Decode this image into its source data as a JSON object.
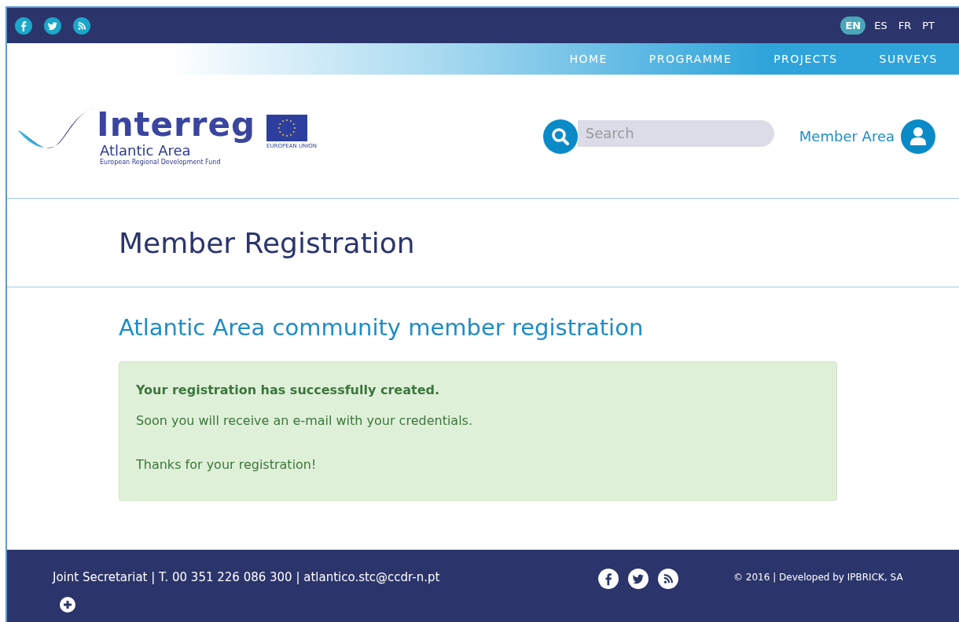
{
  "top_bar": {
    "social": [
      {
        "kind": "facebook"
      },
      {
        "kind": "twitter"
      },
      {
        "kind": "rss"
      }
    ],
    "languages": [
      {
        "label": "EN",
        "selected": true
      },
      {
        "label": "ES",
        "selected": false
      },
      {
        "label": "FR",
        "selected": false
      },
      {
        "label": "PT",
        "selected": false
      }
    ]
  },
  "nav": [
    "HOME",
    "PROGRAMME",
    "PROJECTS",
    "SURVEYS"
  ],
  "logo": {
    "name": "Interreg",
    "region": "Atlantic Area",
    "fund": "European Regional Development Fund",
    "eu": "EUROPEAN UNION"
  },
  "search": {
    "placeholder": "Search"
  },
  "member_area": "Member Area",
  "page_title": "Member Registration",
  "heading": "Atlantic Area community member registration",
  "alert": {
    "title": "Your registration has successfully created.",
    "lines": [
      "Soon you will receive an e-mail with your credentials.",
      "Thanks for your registration!"
    ]
  },
  "footer": {
    "contact": "Joint Secretariat | T. 00 351 226 086 300 | atlantico.stc@ccdr-n.pt",
    "social": [
      {
        "kind": "facebook"
      },
      {
        "kind": "twitter"
      },
      {
        "kind": "rss"
      }
    ],
    "copyright": "© 2016 | Developed by IPBRICK, SA"
  }
}
